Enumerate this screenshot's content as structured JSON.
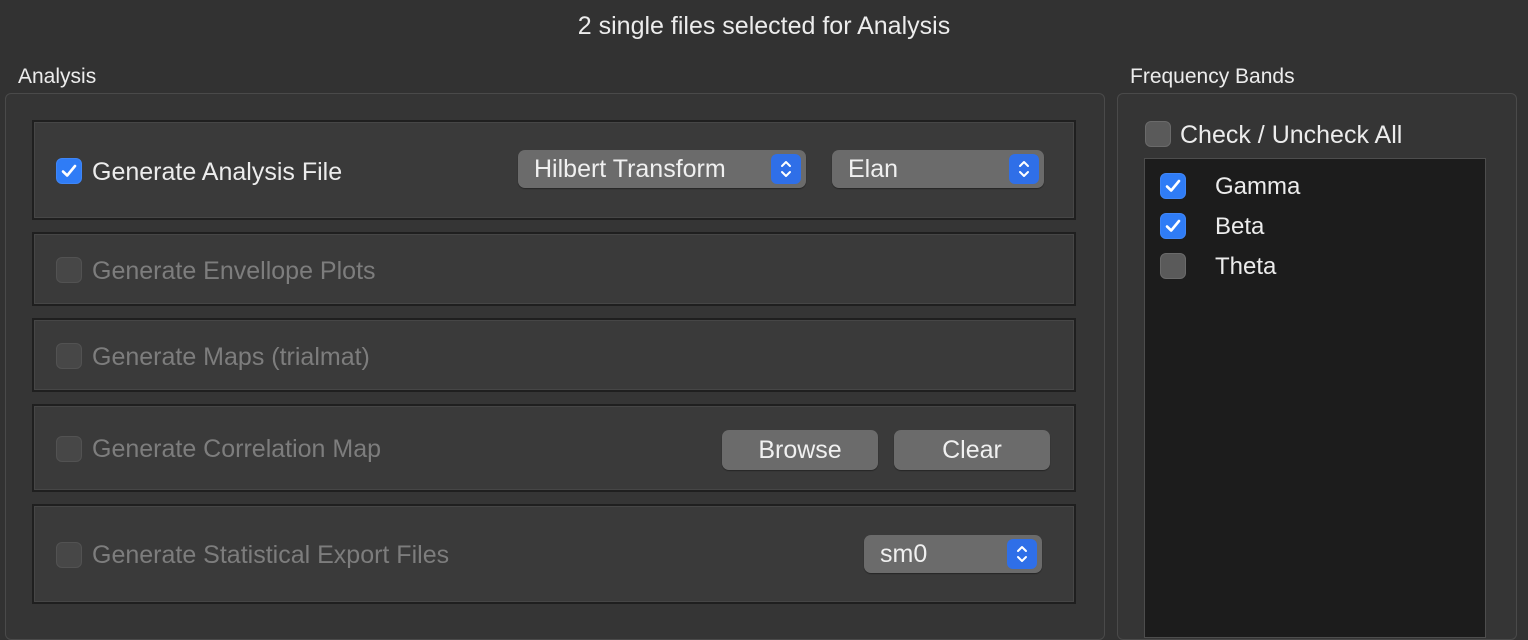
{
  "window": {
    "title": "2 single files selected for Analysis"
  },
  "analysis": {
    "label": "Analysis",
    "rows": [
      {
        "label": "Generate Analysis File",
        "checked": true,
        "enabled": true,
        "method_popup": "Hilbert Transform",
        "format_popup": "Elan"
      },
      {
        "label": "Generate Envellope Plots",
        "checked": false,
        "enabled": false
      },
      {
        "label": "Generate Maps (trialmat)",
        "checked": false,
        "enabled": false
      },
      {
        "label": "Generate Correlation Map",
        "checked": false,
        "enabled": false,
        "browse_label": "Browse",
        "clear_label": "Clear"
      },
      {
        "label": "Generate Statistical Export Files",
        "checked": false,
        "enabled": false,
        "smooth_popup": "sm0"
      }
    ]
  },
  "frequency_bands": {
    "label": "Frequency Bands",
    "check_all_label": "Check / Uncheck All",
    "items": [
      {
        "label": "Gamma",
        "checked": true
      },
      {
        "label": "Beta",
        "checked": true
      },
      {
        "label": "Theta",
        "checked": false
      }
    ]
  },
  "colors": {
    "accent": "#2f7cf6",
    "background": "#323232",
    "list_background": "#1c1c1c"
  }
}
